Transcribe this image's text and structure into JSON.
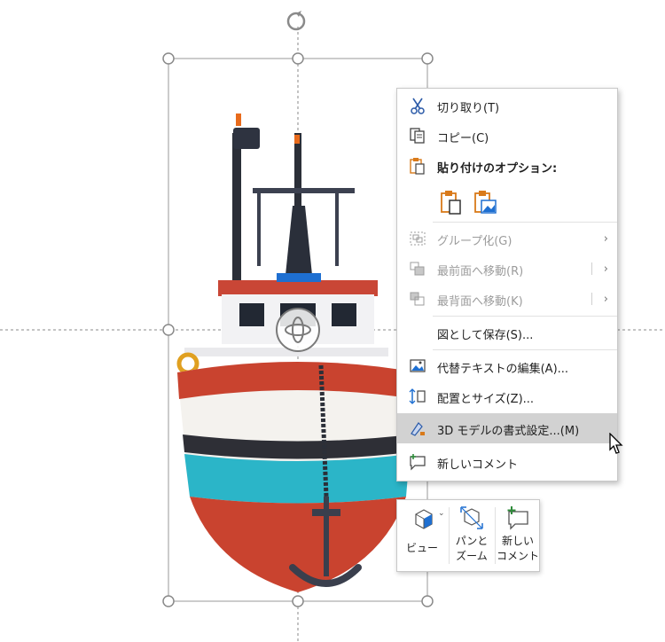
{
  "context_menu": {
    "items": [
      {
        "label": "切り取り(T)",
        "icon": "scissors-icon"
      },
      {
        "label": "コピー(C)",
        "icon": "copy-icon"
      },
      {
        "label": "貼り付けのオプション:",
        "icon": "paste-icon"
      },
      {
        "label": "グループ化(G)",
        "icon": "group-icon",
        "disabled": true
      },
      {
        "label": "最前面へ移動(R)",
        "icon": "bring-to-front-icon",
        "disabled": true
      },
      {
        "label": "最背面へ移動(K)",
        "icon": "send-to-back-icon",
        "disabled": true
      },
      {
        "label": "図として保存(S)..."
      },
      {
        "label": "代替テキストの編集(A)...",
        "icon": "alt-text-icon"
      },
      {
        "label": "配置とサイズ(Z)...",
        "icon": "size-position-icon"
      },
      {
        "label": "3D モデルの書式設定...(M)",
        "icon": "format-3d-model-icon",
        "highlighted": true
      },
      {
        "label": "新しいコメント",
        "icon": "new-comment-icon"
      }
    ],
    "paste_options": [
      "paste-keep-format-icon",
      "paste-as-picture-icon"
    ]
  },
  "mini_toolbar": {
    "view_label": "ビュー",
    "pan_zoom_label_1": "パンと",
    "pan_zoom_label_2": "ズーム",
    "comment_label_1": "新しい",
    "comment_label_2": "コメント"
  },
  "colors": {
    "menu_highlight": "#d2d2d2",
    "paste_icon_orange": "#d97a1a",
    "comment_icon_green": "#2e8b3a",
    "view_icon_blue": "#1e6fd1"
  }
}
